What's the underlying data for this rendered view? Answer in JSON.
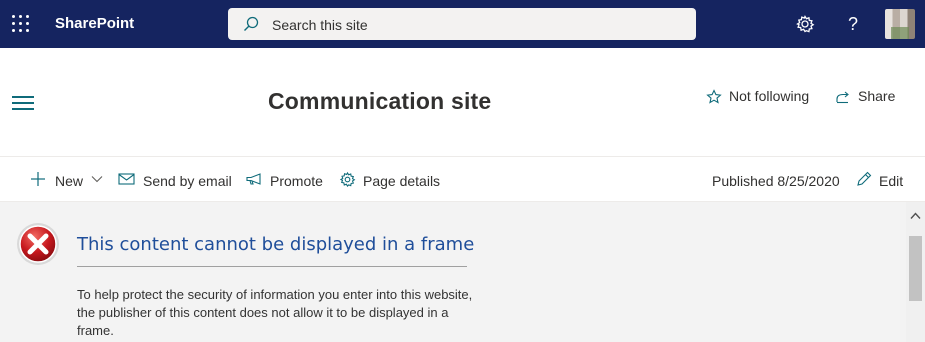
{
  "suite_bar": {
    "app_name": "SharePoint",
    "search_placeholder": "Search this site",
    "help_label": "?"
  },
  "site_header": {
    "title": "Communication site",
    "follow_label": "Not following",
    "share_label": "Share"
  },
  "command_bar": {
    "new_label": "New",
    "send_email_label": "Send by email",
    "promote_label": "Promote",
    "page_details_label": "Page details",
    "published_label": "Published 8/25/2020",
    "edit_label": "Edit"
  },
  "frame_error": {
    "title": "This content cannot be displayed in a frame",
    "body": "To help protect the security of information you enter into this website, the publisher of this content does not allow it to be displayed in a frame."
  },
  "colors": {
    "suite_bar_bg": "#152460",
    "accent": "#0f6b7a",
    "error_title": "#1f4e9a",
    "error_red": "#c7181e"
  },
  "icons": {
    "waffle": "waffle-icon",
    "search": "search-icon",
    "settings": "gear-icon",
    "help": "help-icon",
    "menu": "hamburger-icon",
    "follow": "star-icon",
    "share": "share-icon",
    "new": "plus-icon",
    "dropdown": "chevron-down-icon",
    "email": "mail-icon",
    "promote": "megaphone-icon",
    "details": "gear-icon",
    "edit": "pencil-icon",
    "error": "error-x-icon"
  }
}
